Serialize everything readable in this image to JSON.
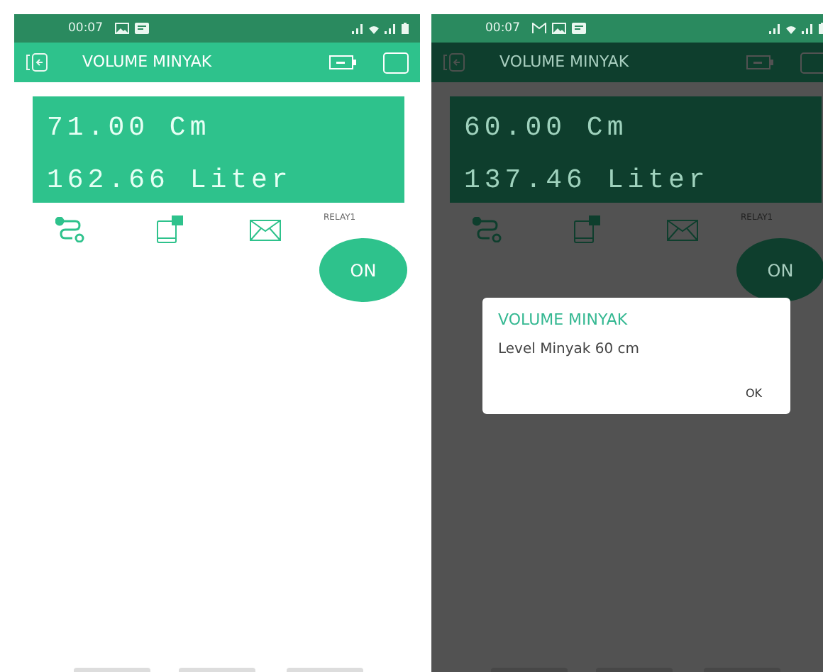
{
  "phones": [
    {
      "status_time": "00:07",
      "status_icons": [
        {
          "kind": "picture"
        },
        {
          "kind": "message"
        }
      ],
      "title": "VOLUME MINYAK",
      "display": [
        "71.00 Cm",
        "162.66 Liter"
      ],
      "relay_label": "RELAY1",
      "button": {
        "label": "ON"
      }
    },
    {
      "status_time": "00:07",
      "status_icons": [
        {
          "kind": "mail"
        },
        {
          "kind": "picture"
        },
        {
          "kind": "message"
        }
      ],
      "title": "VOLUME MINYAK",
      "display": [
        "60.00 Cm",
        "137.46 Liter"
      ],
      "relay_label": "RELAY1",
      "button": {
        "label": "ON"
      },
      "dialog": {
        "title": "VOLUME MINYAK",
        "message": "Level Minyak 60 cm",
        "button": "OK"
      }
    }
  ]
}
